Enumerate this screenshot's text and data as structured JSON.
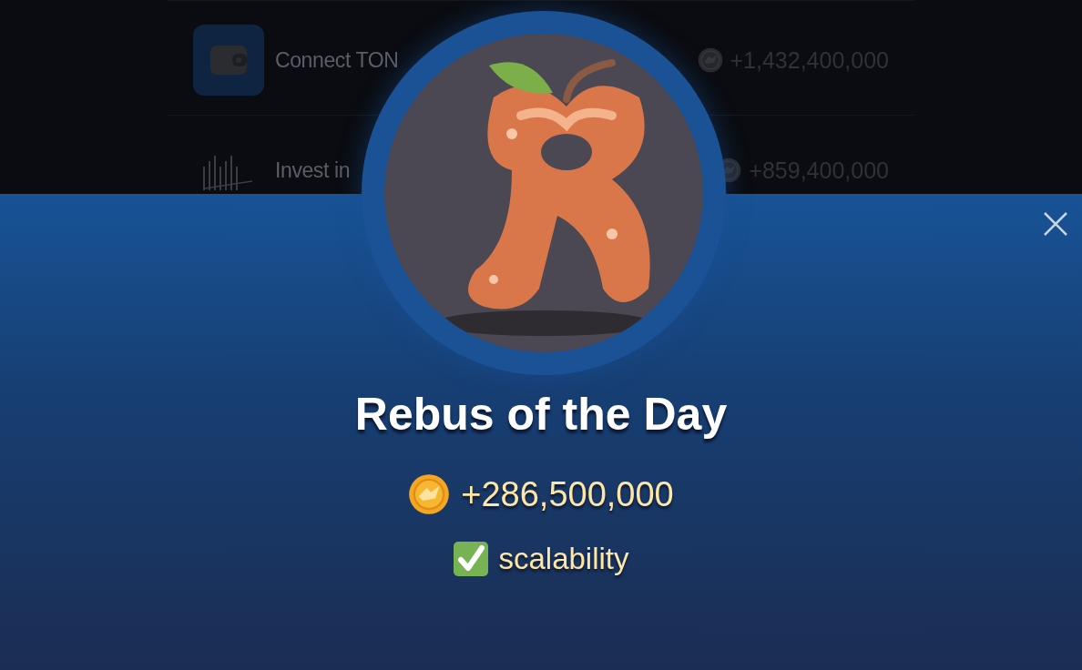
{
  "tasks": [
    {
      "kind": "wallet",
      "title": "Connect TON",
      "reward": "+1,432,400,000"
    },
    {
      "kind": "chart",
      "title": "Invest in",
      "reward": "+859,400,000"
    }
  ],
  "modal": {
    "title": "Rebus of the Day",
    "reward": "+286,500,000",
    "answer": "scalability",
    "solved": true
  }
}
